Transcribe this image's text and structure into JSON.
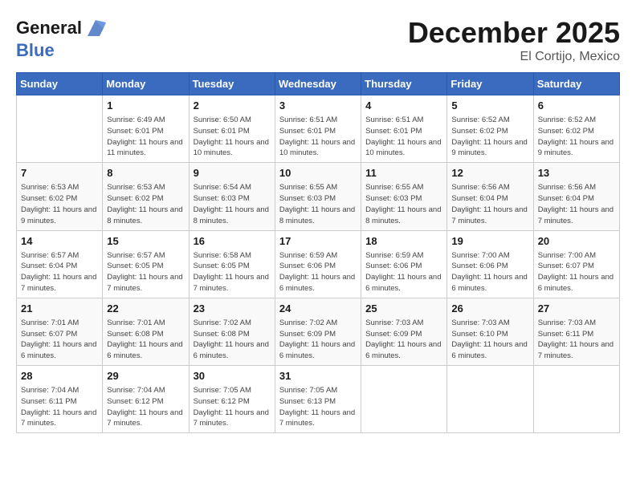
{
  "logo": {
    "part1": "General",
    "part2": "Blue"
  },
  "title": "December 2025",
  "location": "El Cortijo, Mexico",
  "days_of_week": [
    "Sunday",
    "Monday",
    "Tuesday",
    "Wednesday",
    "Thursday",
    "Friday",
    "Saturday"
  ],
  "weeks": [
    [
      {
        "day": "",
        "sunrise": "",
        "sunset": "",
        "daylight": ""
      },
      {
        "day": "1",
        "sunrise": "Sunrise: 6:49 AM",
        "sunset": "Sunset: 6:01 PM",
        "daylight": "Daylight: 11 hours and 11 minutes."
      },
      {
        "day": "2",
        "sunrise": "Sunrise: 6:50 AM",
        "sunset": "Sunset: 6:01 PM",
        "daylight": "Daylight: 11 hours and 10 minutes."
      },
      {
        "day": "3",
        "sunrise": "Sunrise: 6:51 AM",
        "sunset": "Sunset: 6:01 PM",
        "daylight": "Daylight: 11 hours and 10 minutes."
      },
      {
        "day": "4",
        "sunrise": "Sunrise: 6:51 AM",
        "sunset": "Sunset: 6:01 PM",
        "daylight": "Daylight: 11 hours and 10 minutes."
      },
      {
        "day": "5",
        "sunrise": "Sunrise: 6:52 AM",
        "sunset": "Sunset: 6:02 PM",
        "daylight": "Daylight: 11 hours and 9 minutes."
      },
      {
        "day": "6",
        "sunrise": "Sunrise: 6:52 AM",
        "sunset": "Sunset: 6:02 PM",
        "daylight": "Daylight: 11 hours and 9 minutes."
      }
    ],
    [
      {
        "day": "7",
        "sunrise": "Sunrise: 6:53 AM",
        "sunset": "Sunset: 6:02 PM",
        "daylight": "Daylight: 11 hours and 9 minutes."
      },
      {
        "day": "8",
        "sunrise": "Sunrise: 6:53 AM",
        "sunset": "Sunset: 6:02 PM",
        "daylight": "Daylight: 11 hours and 8 minutes."
      },
      {
        "day": "9",
        "sunrise": "Sunrise: 6:54 AM",
        "sunset": "Sunset: 6:03 PM",
        "daylight": "Daylight: 11 hours and 8 minutes."
      },
      {
        "day": "10",
        "sunrise": "Sunrise: 6:55 AM",
        "sunset": "Sunset: 6:03 PM",
        "daylight": "Daylight: 11 hours and 8 minutes."
      },
      {
        "day": "11",
        "sunrise": "Sunrise: 6:55 AM",
        "sunset": "Sunset: 6:03 PM",
        "daylight": "Daylight: 11 hours and 8 minutes."
      },
      {
        "day": "12",
        "sunrise": "Sunrise: 6:56 AM",
        "sunset": "Sunset: 6:04 PM",
        "daylight": "Daylight: 11 hours and 7 minutes."
      },
      {
        "day": "13",
        "sunrise": "Sunrise: 6:56 AM",
        "sunset": "Sunset: 6:04 PM",
        "daylight": "Daylight: 11 hours and 7 minutes."
      }
    ],
    [
      {
        "day": "14",
        "sunrise": "Sunrise: 6:57 AM",
        "sunset": "Sunset: 6:04 PM",
        "daylight": "Daylight: 11 hours and 7 minutes."
      },
      {
        "day": "15",
        "sunrise": "Sunrise: 6:57 AM",
        "sunset": "Sunset: 6:05 PM",
        "daylight": "Daylight: 11 hours and 7 minutes."
      },
      {
        "day": "16",
        "sunrise": "Sunrise: 6:58 AM",
        "sunset": "Sunset: 6:05 PM",
        "daylight": "Daylight: 11 hours and 7 minutes."
      },
      {
        "day": "17",
        "sunrise": "Sunrise: 6:59 AM",
        "sunset": "Sunset: 6:06 PM",
        "daylight": "Daylight: 11 hours and 6 minutes."
      },
      {
        "day": "18",
        "sunrise": "Sunrise: 6:59 AM",
        "sunset": "Sunset: 6:06 PM",
        "daylight": "Daylight: 11 hours and 6 minutes."
      },
      {
        "day": "19",
        "sunrise": "Sunrise: 7:00 AM",
        "sunset": "Sunset: 6:06 PM",
        "daylight": "Daylight: 11 hours and 6 minutes."
      },
      {
        "day": "20",
        "sunrise": "Sunrise: 7:00 AM",
        "sunset": "Sunset: 6:07 PM",
        "daylight": "Daylight: 11 hours and 6 minutes."
      }
    ],
    [
      {
        "day": "21",
        "sunrise": "Sunrise: 7:01 AM",
        "sunset": "Sunset: 6:07 PM",
        "daylight": "Daylight: 11 hours and 6 minutes."
      },
      {
        "day": "22",
        "sunrise": "Sunrise: 7:01 AM",
        "sunset": "Sunset: 6:08 PM",
        "daylight": "Daylight: 11 hours and 6 minutes."
      },
      {
        "day": "23",
        "sunrise": "Sunrise: 7:02 AM",
        "sunset": "Sunset: 6:08 PM",
        "daylight": "Daylight: 11 hours and 6 minutes."
      },
      {
        "day": "24",
        "sunrise": "Sunrise: 7:02 AM",
        "sunset": "Sunset: 6:09 PM",
        "daylight": "Daylight: 11 hours and 6 minutes."
      },
      {
        "day": "25",
        "sunrise": "Sunrise: 7:03 AM",
        "sunset": "Sunset: 6:09 PM",
        "daylight": "Daylight: 11 hours and 6 minutes."
      },
      {
        "day": "26",
        "sunrise": "Sunrise: 7:03 AM",
        "sunset": "Sunset: 6:10 PM",
        "daylight": "Daylight: 11 hours and 6 minutes."
      },
      {
        "day": "27",
        "sunrise": "Sunrise: 7:03 AM",
        "sunset": "Sunset: 6:11 PM",
        "daylight": "Daylight: 11 hours and 7 minutes."
      }
    ],
    [
      {
        "day": "28",
        "sunrise": "Sunrise: 7:04 AM",
        "sunset": "Sunset: 6:11 PM",
        "daylight": "Daylight: 11 hours and 7 minutes."
      },
      {
        "day": "29",
        "sunrise": "Sunrise: 7:04 AM",
        "sunset": "Sunset: 6:12 PM",
        "daylight": "Daylight: 11 hours and 7 minutes."
      },
      {
        "day": "30",
        "sunrise": "Sunrise: 7:05 AM",
        "sunset": "Sunset: 6:12 PM",
        "daylight": "Daylight: 11 hours and 7 minutes."
      },
      {
        "day": "31",
        "sunrise": "Sunrise: 7:05 AM",
        "sunset": "Sunset: 6:13 PM",
        "daylight": "Daylight: 11 hours and 7 minutes."
      },
      {
        "day": "",
        "sunrise": "",
        "sunset": "",
        "daylight": ""
      },
      {
        "day": "",
        "sunrise": "",
        "sunset": "",
        "daylight": ""
      },
      {
        "day": "",
        "sunrise": "",
        "sunset": "",
        "daylight": ""
      }
    ]
  ]
}
